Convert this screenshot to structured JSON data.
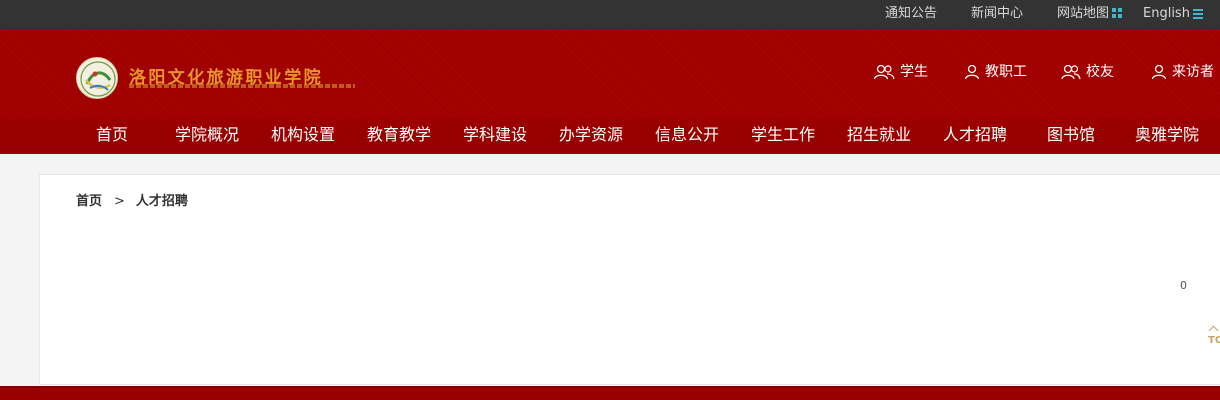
{
  "topbar": {
    "notice": "通知公告",
    "news": "新闻中心",
    "sitemap": "网站地图",
    "english": "English",
    "icon_color": "#3fb8c9"
  },
  "header": {
    "school_name": "洛阳文化旅游职业学院",
    "roles": [
      "学生",
      "教职工",
      "校友",
      "来访者"
    ],
    "nav": [
      "首页",
      "学院概况",
      "机构设置",
      "教育教学",
      "学科建设",
      "办学资源",
      "信息公开",
      "学生工作",
      "招生就业",
      "人才招聘",
      "图书馆",
      "奥雅学院"
    ],
    "background_color": "#a00000"
  },
  "breadcrumb": {
    "home": "首页",
    "separator": ">",
    "current": "人才招聘"
  },
  "content": {
    "count": "0"
  },
  "totop": {
    "label": "TOP"
  }
}
